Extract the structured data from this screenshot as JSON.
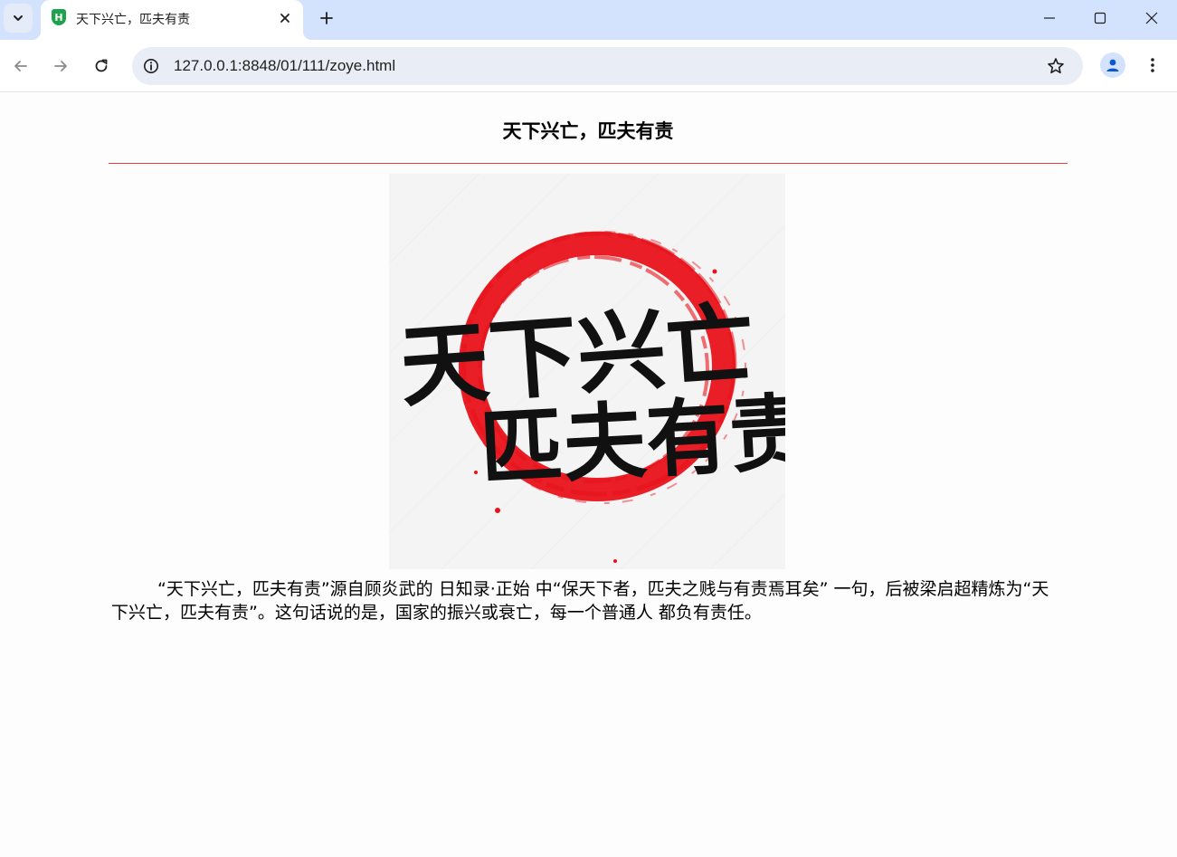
{
  "tab": {
    "favicon_letter": "H",
    "title": "天下兴亡，匹夫有责"
  },
  "omnibox": {
    "url": "127.0.0.1:8848/01/111/zoye.html"
  },
  "page": {
    "heading": "天下兴亡，匹夫有责",
    "poster": {
      "line1": "天下兴亡",
      "line2": "匹夫有责"
    },
    "paragraph": "“天下兴亡，匹夫有责”源自顾炎武的 日知录·正始 中“保天下者，匹夫之贱与有责焉耳矣” 一句，后被梁启超精炼为“天下兴亡，匹夫有责”。这句话说的是，国家的振兴或衰亡，每一个普通人 都负有责任。"
  },
  "colors": {
    "tabstrip": "#d3e3fd",
    "omnibox": "#e9eef6",
    "rule": "#e23c3c",
    "brush_red": "#e8121a",
    "favicon": "#1fa14d"
  },
  "icons": [
    "tab-search-icon",
    "close-icon",
    "plus-icon",
    "minimize-icon",
    "maximize-icon",
    "back-icon",
    "forward-icon",
    "reload-icon",
    "info-icon",
    "star-icon",
    "person-icon",
    "kebab-menu-icon"
  ]
}
